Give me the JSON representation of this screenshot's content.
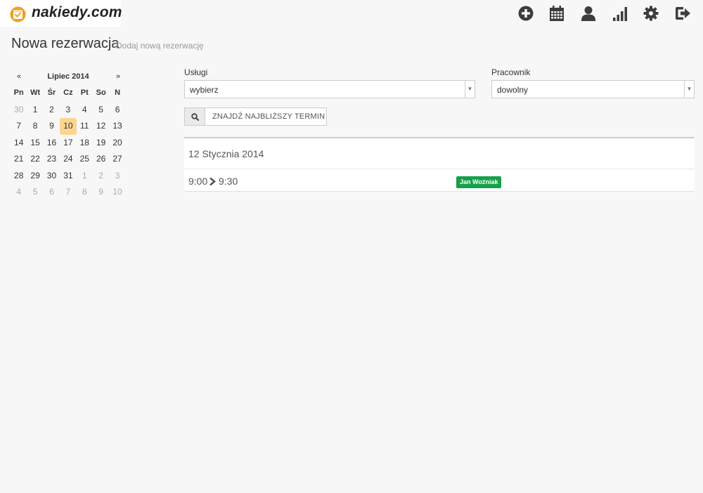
{
  "app": {
    "logo_text": "nakiedy.com",
    "accent": "#f0a020",
    "success": "#15a14a",
    "highlight": "#fcd58f"
  },
  "nav": {
    "icons": [
      "plus-circle-icon",
      "calendar-icon",
      "user-icon",
      "stats-bars-icon",
      "gear-icon",
      "logout-icon"
    ]
  },
  "page": {
    "title": "Nowa rezerwacja",
    "subtitle": "Dodaj nową rezerwację"
  },
  "calendar": {
    "prev": "«",
    "next": "»",
    "month": "Lipiec 2014",
    "weekdays": [
      "Pn",
      "Wt",
      "Śr",
      "Cz",
      "Pt",
      "So",
      "N"
    ],
    "weeks": [
      [
        {
          "d": "30",
          "o": true
        },
        {
          "d": "1"
        },
        {
          "d": "2"
        },
        {
          "d": "3"
        },
        {
          "d": "4"
        },
        {
          "d": "5"
        },
        {
          "d": "6"
        }
      ],
      [
        {
          "d": "7"
        },
        {
          "d": "8"
        },
        {
          "d": "9"
        },
        {
          "d": "10",
          "t": true
        },
        {
          "d": "11"
        },
        {
          "d": "12"
        },
        {
          "d": "13"
        }
      ],
      [
        {
          "d": "14"
        },
        {
          "d": "15"
        },
        {
          "d": "16"
        },
        {
          "d": "17"
        },
        {
          "d": "18"
        },
        {
          "d": "19"
        },
        {
          "d": "20"
        }
      ],
      [
        {
          "d": "21"
        },
        {
          "d": "22"
        },
        {
          "d": "23"
        },
        {
          "d": "24"
        },
        {
          "d": "25"
        },
        {
          "d": "26"
        },
        {
          "d": "27"
        }
      ],
      [
        {
          "d": "28"
        },
        {
          "d": "29"
        },
        {
          "d": "30"
        },
        {
          "d": "31"
        },
        {
          "d": "1",
          "o": true
        },
        {
          "d": "2",
          "o": true
        },
        {
          "d": "3",
          "o": true
        }
      ],
      [
        {
          "d": "4",
          "o": true
        },
        {
          "d": "5",
          "o": true
        },
        {
          "d": "6",
          "o": true
        },
        {
          "d": "7",
          "o": true
        },
        {
          "d": "8",
          "o": true
        },
        {
          "d": "9",
          "o": true
        },
        {
          "d": "10",
          "o": true
        }
      ]
    ]
  },
  "form": {
    "services": {
      "label": "Usługi",
      "value": "wybierz"
    },
    "employee": {
      "label": "Pracownik",
      "value": "dowolny"
    },
    "find_button": "ZNAJDŹ NAJBLIŻSZY TERMIN"
  },
  "results": {
    "date": "12 Stycznia 2014",
    "slot": {
      "start": "9:00",
      "end": "9:30",
      "employee": "Jan Woźniak"
    }
  }
}
